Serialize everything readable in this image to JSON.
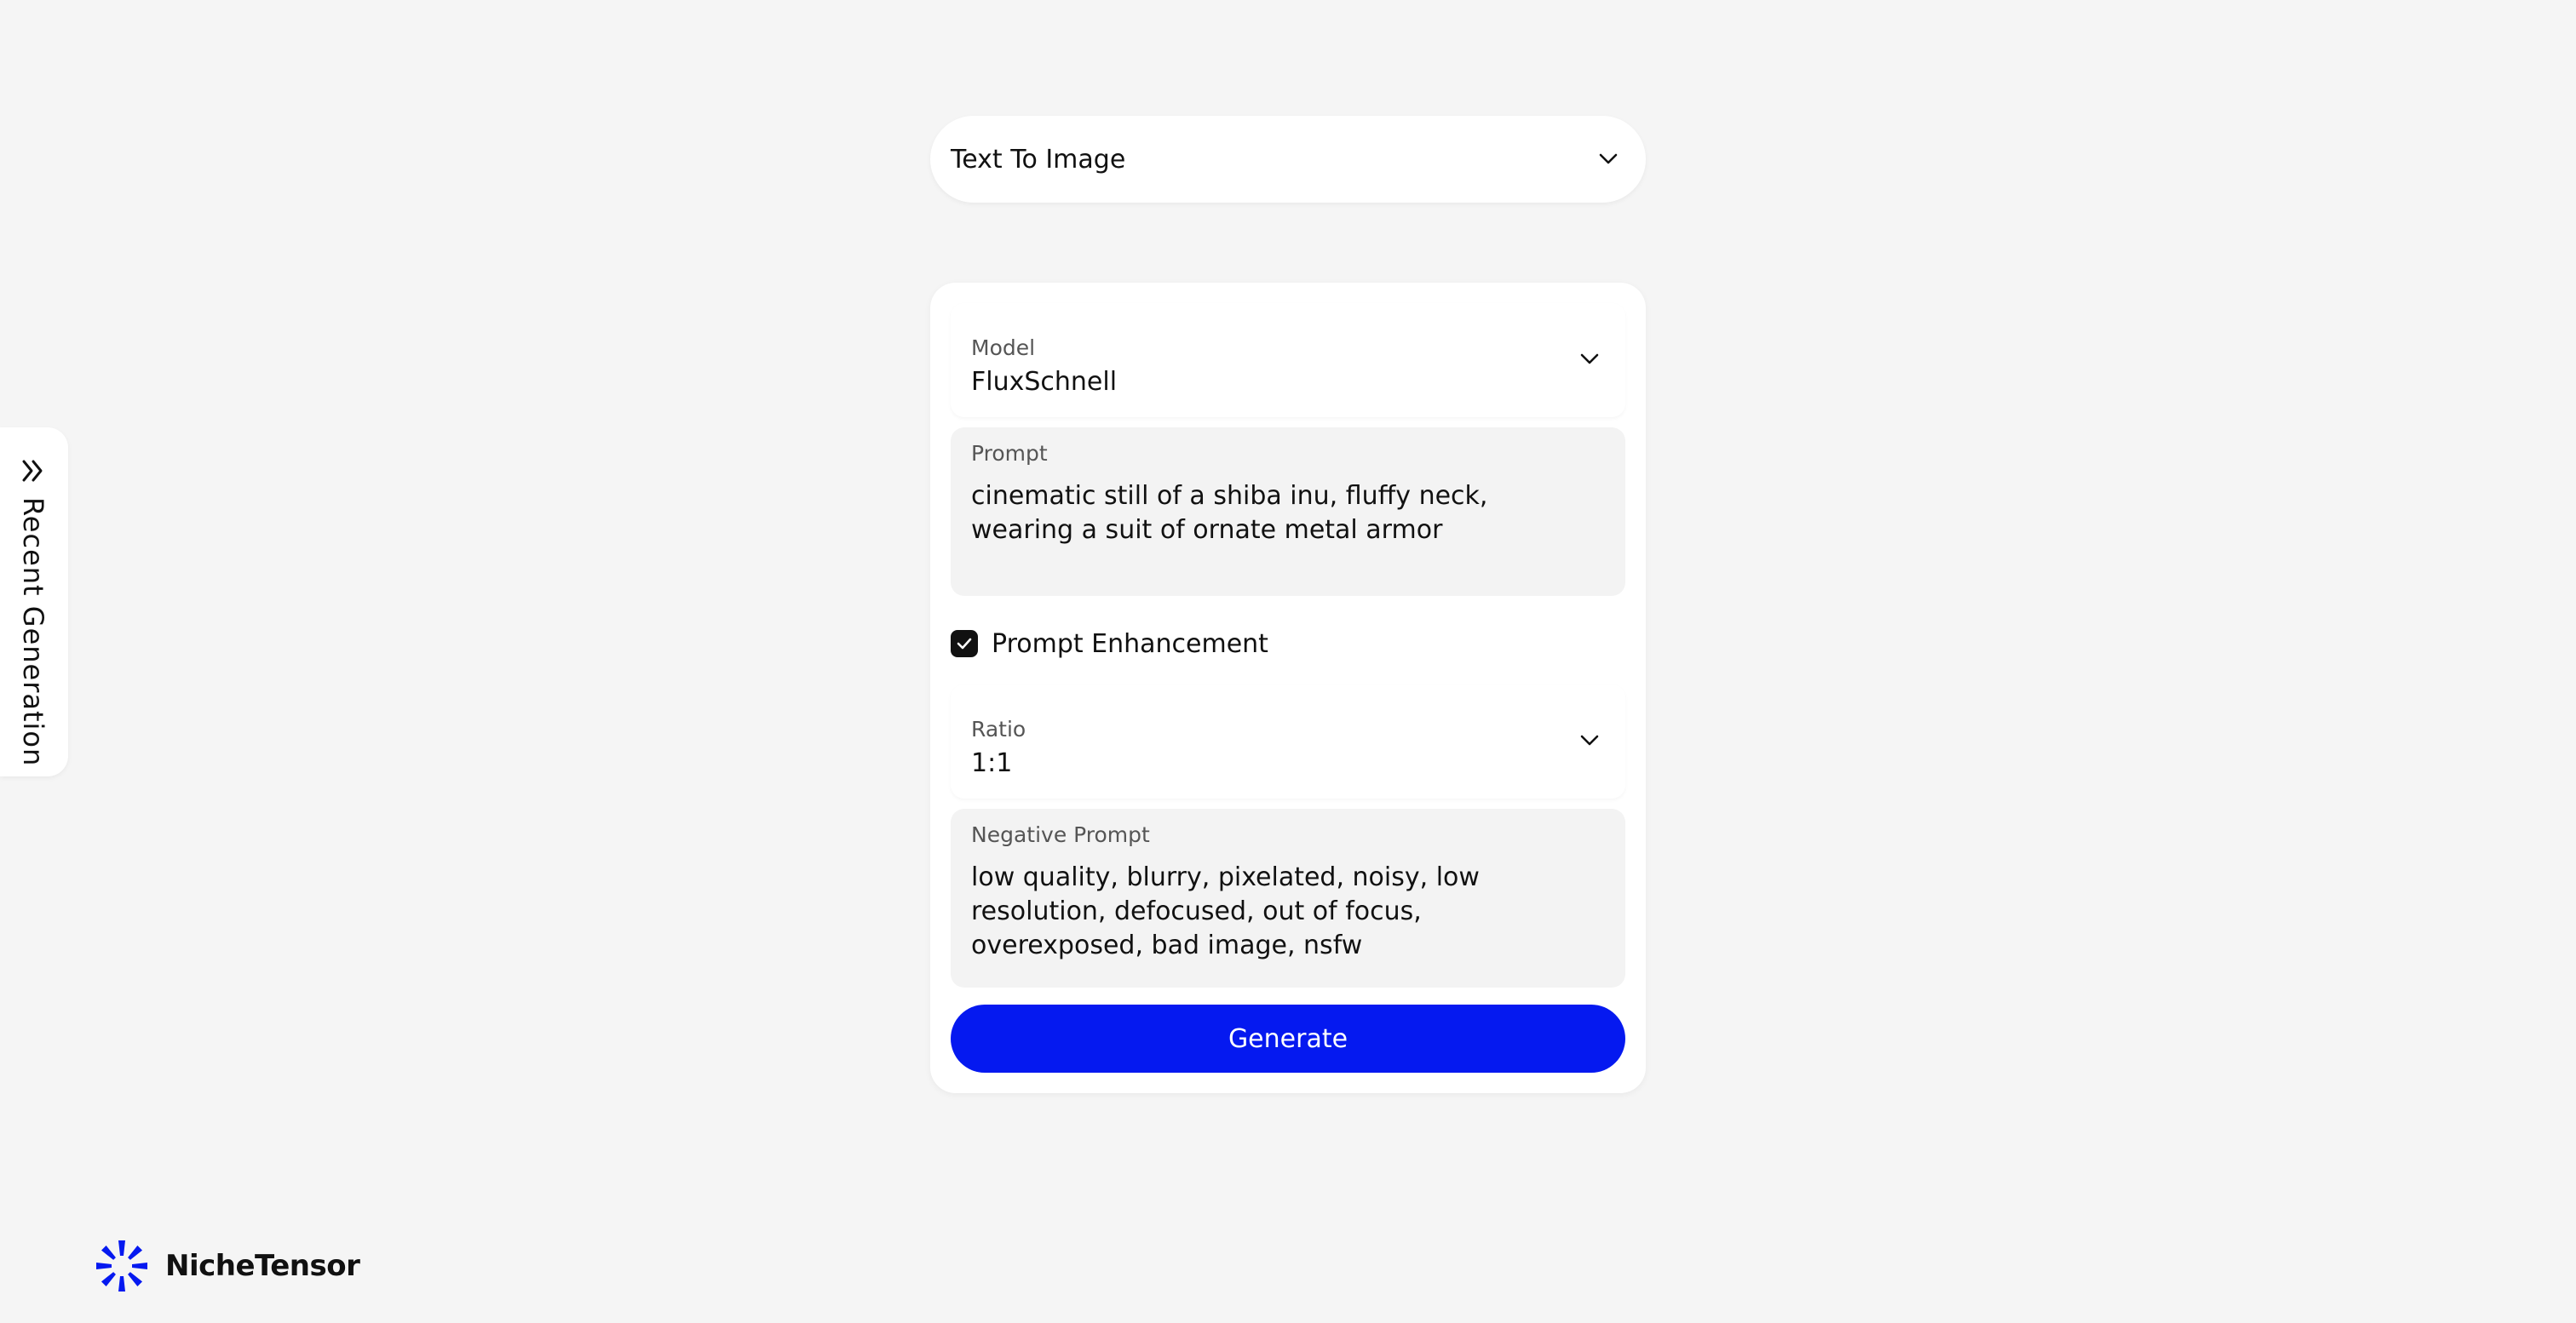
{
  "mode_selector": {
    "value": "Text To Image",
    "icon": "chevron-down-icon"
  },
  "form": {
    "model": {
      "label": "Model",
      "value": "FluxSchnell"
    },
    "prompt": {
      "label": "Prompt",
      "value": "cinematic still of a shiba inu, fluffy neck, wearing a suit of ornate metal armor"
    },
    "prompt_enhancement": {
      "label": "Prompt Enhancement",
      "checked": true
    },
    "ratio": {
      "label": "Ratio",
      "value": "1:1"
    },
    "negative_prompt": {
      "label": "Negative Prompt",
      "value": "low quality, blurry, pixelated, noisy, low resolution, defocused, out of focus, overexposed, bad image, nsfw"
    },
    "generate_label": "Generate"
  },
  "sidebar_tab": {
    "label": "Recent Generation",
    "icon": "double-chevron-right-icon"
  },
  "brand": {
    "name": "NicheTensor",
    "icon": "nichetensor-logo-icon"
  },
  "colors": {
    "background": "#f5f5f5",
    "accent": "#0519f0",
    "card": "#ffffff",
    "text_field_bg": "#f3f3f3"
  }
}
